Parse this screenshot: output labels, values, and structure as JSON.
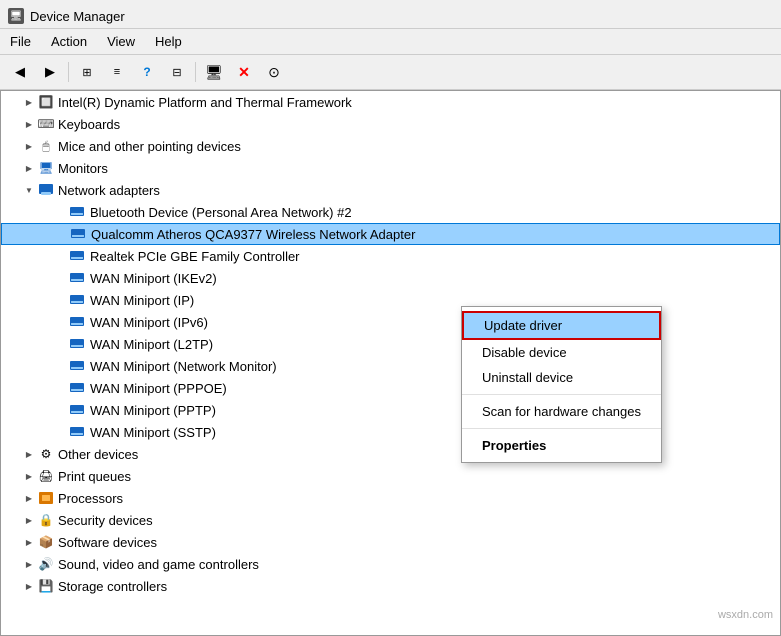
{
  "window": {
    "title": "Device Manager"
  },
  "menu": {
    "items": [
      "File",
      "Action",
      "View",
      "Help"
    ]
  },
  "toolbar": {
    "buttons": [
      {
        "name": "back",
        "icon": "◀"
      },
      {
        "name": "forward",
        "icon": "▶"
      },
      {
        "name": "toolbar-btn3",
        "icon": "⊞"
      },
      {
        "name": "toolbar-btn4",
        "icon": "≡"
      },
      {
        "name": "toolbar-btn5",
        "icon": "?"
      },
      {
        "name": "toolbar-btn6",
        "icon": "⊟"
      },
      {
        "name": "toolbar-btn7",
        "icon": "⊡"
      },
      {
        "name": "toolbar-btn8",
        "icon": "🖥"
      },
      {
        "name": "toolbar-btn9",
        "icon": "✕"
      },
      {
        "name": "toolbar-btn10",
        "icon": "⊙"
      }
    ]
  },
  "tree": {
    "items": [
      {
        "id": "intel",
        "label": "Intel(R) Dynamic Platform and Thermal Framework",
        "indent": 1,
        "expanded": false,
        "icon": "chip"
      },
      {
        "id": "keyboards",
        "label": "Keyboards",
        "indent": 1,
        "expanded": false,
        "icon": "keyboard"
      },
      {
        "id": "mice",
        "label": "Mice and other pointing devices",
        "indent": 1,
        "expanded": false,
        "icon": "mouse"
      },
      {
        "id": "monitors",
        "label": "Monitors",
        "indent": 1,
        "expanded": false,
        "icon": "monitor"
      },
      {
        "id": "network",
        "label": "Network adapters",
        "indent": 1,
        "expanded": true,
        "icon": "network"
      },
      {
        "id": "bluetooth",
        "label": "Bluetooth Device (Personal Area Network) #2",
        "indent": 2,
        "icon": "network-card"
      },
      {
        "id": "qualcomm",
        "label": "Qualcomm Atheros QCA9377 Wireless Network Adapter",
        "indent": 2,
        "icon": "network-card",
        "selected": true
      },
      {
        "id": "realtek",
        "label": "Realtek PCIe GBE Family Controller",
        "indent": 2,
        "icon": "network-card"
      },
      {
        "id": "wan-ikev2",
        "label": "WAN Miniport (IKEv2)",
        "indent": 2,
        "icon": "network-card"
      },
      {
        "id": "wan-ip",
        "label": "WAN Miniport (IP)",
        "indent": 2,
        "icon": "network-card"
      },
      {
        "id": "wan-ipv6",
        "label": "WAN Miniport (IPv6)",
        "indent": 2,
        "icon": "network-card"
      },
      {
        "id": "wan-l2tp",
        "label": "WAN Miniport (L2TP)",
        "indent": 2,
        "icon": "network-card"
      },
      {
        "id": "wan-netmon",
        "label": "WAN Miniport (Network Monitor)",
        "indent": 2,
        "icon": "network-card"
      },
      {
        "id": "wan-pppoe",
        "label": "WAN Miniport (PPPOE)",
        "indent": 2,
        "icon": "network-card"
      },
      {
        "id": "wan-pptp",
        "label": "WAN Miniport (PPTP)",
        "indent": 2,
        "icon": "network-card"
      },
      {
        "id": "wan-sstp",
        "label": "WAN Miniport (SSTP)",
        "indent": 2,
        "icon": "network-card"
      },
      {
        "id": "other",
        "label": "Other devices",
        "indent": 1,
        "expanded": false,
        "icon": "other"
      },
      {
        "id": "print",
        "label": "Print queues",
        "indent": 1,
        "expanded": false,
        "icon": "printer"
      },
      {
        "id": "processors",
        "label": "Processors",
        "indent": 1,
        "expanded": false,
        "icon": "processor"
      },
      {
        "id": "security",
        "label": "Security devices",
        "indent": 1,
        "expanded": false,
        "icon": "security"
      },
      {
        "id": "software",
        "label": "Software devices",
        "indent": 1,
        "expanded": false,
        "icon": "software"
      },
      {
        "id": "sound",
        "label": "Sound, video and game controllers",
        "indent": 1,
        "expanded": false,
        "icon": "sound"
      },
      {
        "id": "storage",
        "label": "Storage controllers",
        "indent": 1,
        "expanded": false,
        "icon": "storage"
      }
    ]
  },
  "context_menu": {
    "items": [
      {
        "id": "update-driver",
        "label": "Update driver",
        "highlighted": true
      },
      {
        "id": "disable-device",
        "label": "Disable device"
      },
      {
        "id": "uninstall-device",
        "label": "Uninstall device"
      },
      {
        "id": "sep1",
        "type": "separator"
      },
      {
        "id": "scan-changes",
        "label": "Scan for hardware changes"
      },
      {
        "id": "sep2",
        "type": "separator"
      },
      {
        "id": "properties",
        "label": "Properties",
        "bold": true
      }
    ]
  },
  "watermark": "wsxdn.com"
}
